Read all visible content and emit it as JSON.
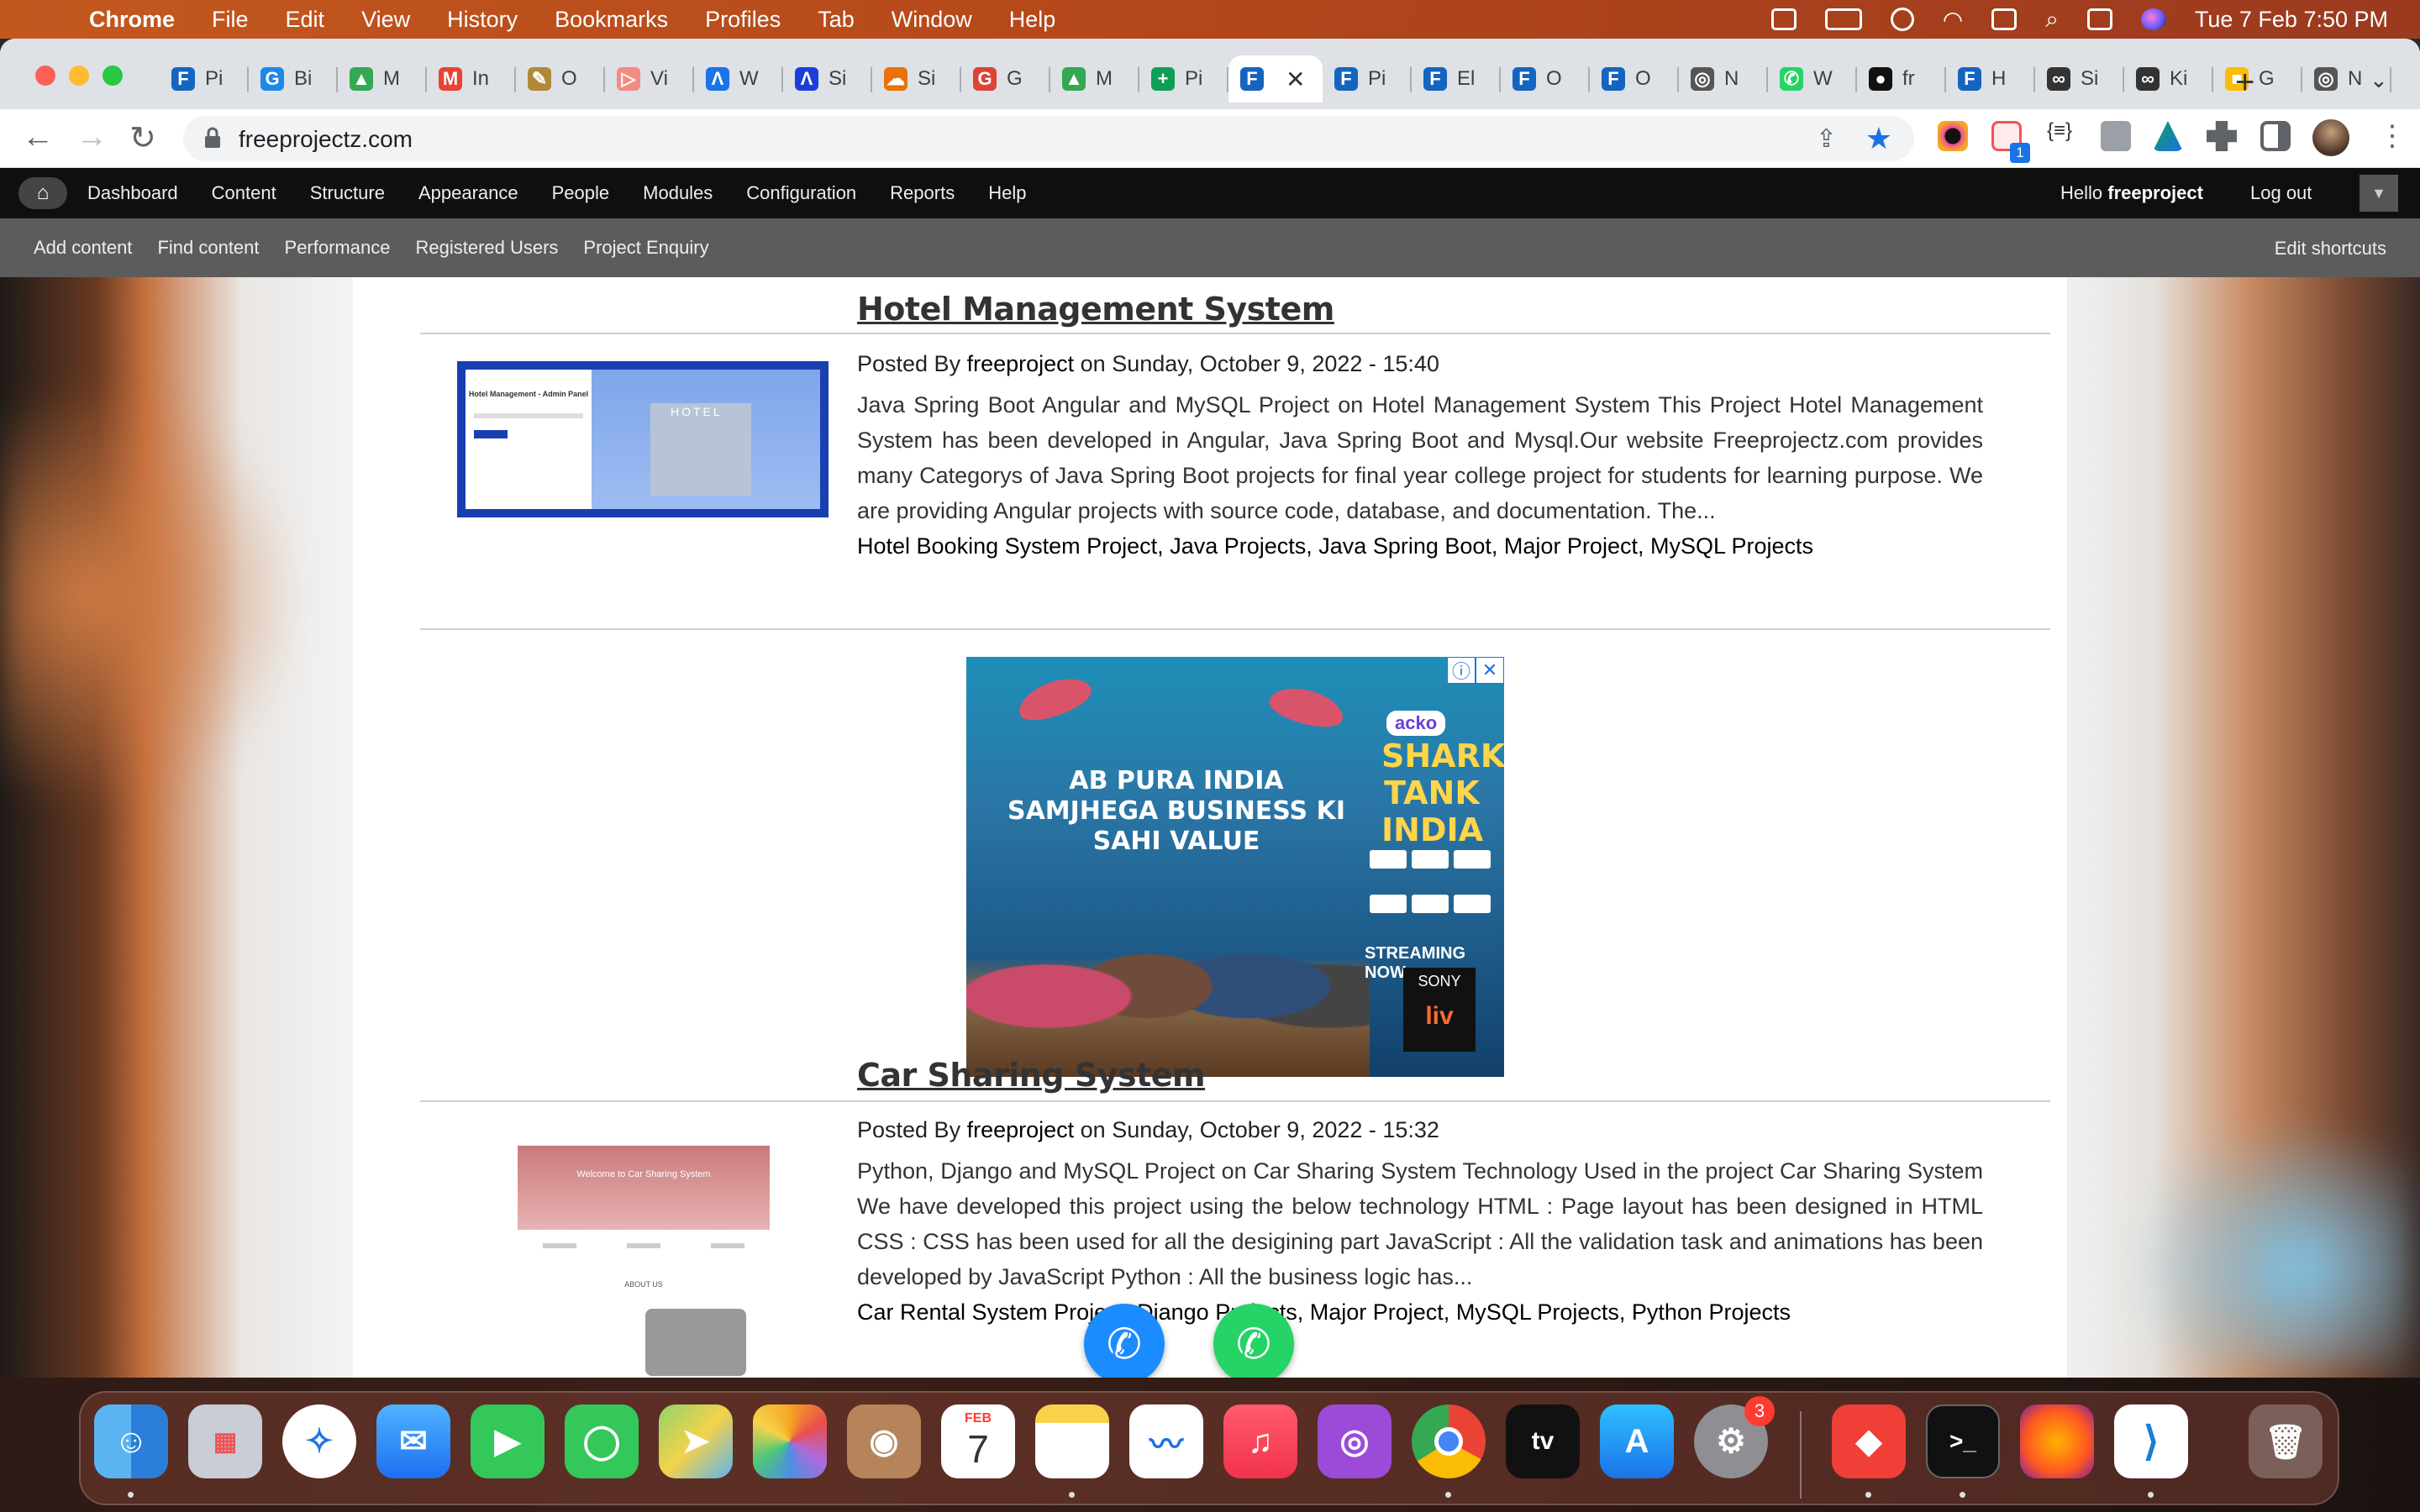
{
  "menubar": {
    "app": "Chrome",
    "items": [
      "File",
      "Edit",
      "View",
      "History",
      "Bookmarks",
      "Profiles",
      "Tab",
      "Window",
      "Help"
    ],
    "clock": "Tue 7 Feb  7:50 PM"
  },
  "tabs": [
    {
      "letter": "F",
      "label": "Pi",
      "color": "#1565c0"
    },
    {
      "letter": "G",
      "label": "Bi",
      "color": "#1e88e5"
    },
    {
      "letter": "▲",
      "label": "M",
      "color": "#34a853"
    },
    {
      "letter": "M",
      "label": "In",
      "color": "#ea4335"
    },
    {
      "letter": "✎",
      "label": "O",
      "color": "#b08a3a"
    },
    {
      "letter": "▷",
      "label": "Vi",
      "color": "#f28b82"
    },
    {
      "letter": "Λ",
      "label": "W",
      "color": "#1a73e8"
    },
    {
      "letter": "Λ",
      "label": "Si",
      "color": "#1a3fd8"
    },
    {
      "letter": "☁",
      "label": "Si",
      "color": "#e8710a"
    },
    {
      "letter": "G",
      "label": "G",
      "color": "#db4437"
    },
    {
      "letter": "▲",
      "label": "M",
      "color": "#34a853"
    },
    {
      "letter": "+",
      "label": "Pi",
      "color": "#0f9d58"
    },
    {
      "letter": "F",
      "label": "",
      "color": "#1565c0",
      "active": true
    },
    {
      "letter": "F",
      "label": "Pi",
      "color": "#1565c0"
    },
    {
      "letter": "F",
      "label": "El",
      "color": "#1565c0"
    },
    {
      "letter": "F",
      "label": "O",
      "color": "#1565c0"
    },
    {
      "letter": "F",
      "label": "O",
      "color": "#1565c0"
    },
    {
      "letter": "◎",
      "label": "N",
      "color": "#555"
    },
    {
      "letter": "✆",
      "label": "W",
      "color": "#25d366"
    },
    {
      "letter": "●",
      "label": "fr",
      "color": "#111"
    },
    {
      "letter": "F",
      "label": "H",
      "color": "#1565c0"
    },
    {
      "letter": "∞",
      "label": "Si",
      "color": "#333"
    },
    {
      "letter": "∞",
      "label": "Ki",
      "color": "#333"
    },
    {
      "letter": "■",
      "label": "G",
      "color": "#fbbc04"
    },
    {
      "letter": "◎",
      "label": "N",
      "color": "#555"
    }
  ],
  "address": {
    "url": "freeprojectz.com"
  },
  "extension_badge": "1",
  "admin_toolbar": {
    "items": [
      "Dashboard",
      "Content",
      "Structure",
      "Appearance",
      "People",
      "Modules",
      "Configuration",
      "Reports",
      "Help"
    ],
    "hello_prefix": "Hello ",
    "username": "freeproject",
    "logout": "Log out"
  },
  "shortcuts": {
    "items": [
      "Add content",
      "Find content",
      "Performance",
      "Registered Users",
      "Project Enquiry"
    ],
    "edit": "Edit shortcuts"
  },
  "articles": [
    {
      "title": "Hotel Management System",
      "posted_by": "Posted By ",
      "author": "freeproject",
      "date": " on Sunday, October 9, 2022 - 15:40",
      "body": "Java Spring Boot Angular and MySQL Project on Hotel Management System This Project Hotel Management System has been developed in Angular, Java Spring Boot and Mysql.Our website Freeprojectz.com provides many Categorys of Java Spring Boot projects for final year college project for students for learning purpose. We are providing Angular projects with source code, database, and documentation. The...",
      "tags": [
        "Hotel Booking System Project",
        "Java Projects",
        "Java Spring Boot",
        "Major Project",
        "MySQL Projects"
      ],
      "thumb_text": "Hotel Management - Admin Panel",
      "thumb_sign": "HOTEL"
    },
    {
      "title": "Car Sharing System",
      "posted_by": "Posted By ",
      "author": "freeproject",
      "date": " on Sunday, October 9, 2022 - 15:32",
      "body": "Python, Django and MySQL Project on Car Sharing System Technology Used in the project Car Sharing System We have developed this project using the below technology HTML : Page layout has been designed in HTML CSS : CSS has been used for all the desigining part JavaScript : All the validation task and animations has been developed by JavaScript Python : All the business logic has...",
      "tags": [
        "Car Rental System Project",
        "Django Projects",
        "Major Project",
        "MySQL Projects",
        "Python Projects"
      ],
      "thumb_text": "Welcome to Car Sharing System",
      "thumb_about": "ABOUT US"
    }
  ],
  "ad": {
    "headline": "AB PURA INDIA SAMJHEGA BUSINESS KI SAHI VALUE",
    "brand": "acko",
    "show": "SHARK TANK INDIA",
    "streaming": "STREAMING NOW",
    "network": "SONY",
    "platform": "liv"
  },
  "dock": {
    "calendar_month": "FEB",
    "calendar_day": "7",
    "settings_badge": "3"
  }
}
